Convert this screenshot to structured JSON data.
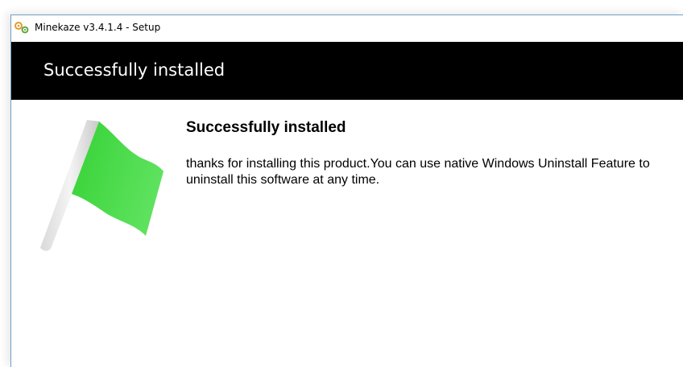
{
  "window": {
    "title": "Minekaze v3.4.1.4 - Setup",
    "app_icon": "gears-icon"
  },
  "banner": {
    "title": "Successfully installed"
  },
  "content": {
    "image_icon": "green-flag-icon",
    "heading": "Successfully installed",
    "message": "thanks for installing this product.You can use native Windows Uninstall Feature to uninstall this software at any time."
  },
  "colors": {
    "banner_background": "#000000",
    "banner_text": "#ffffff",
    "flag_green": "#3fd43f",
    "window_border": "#6f9ec7"
  }
}
